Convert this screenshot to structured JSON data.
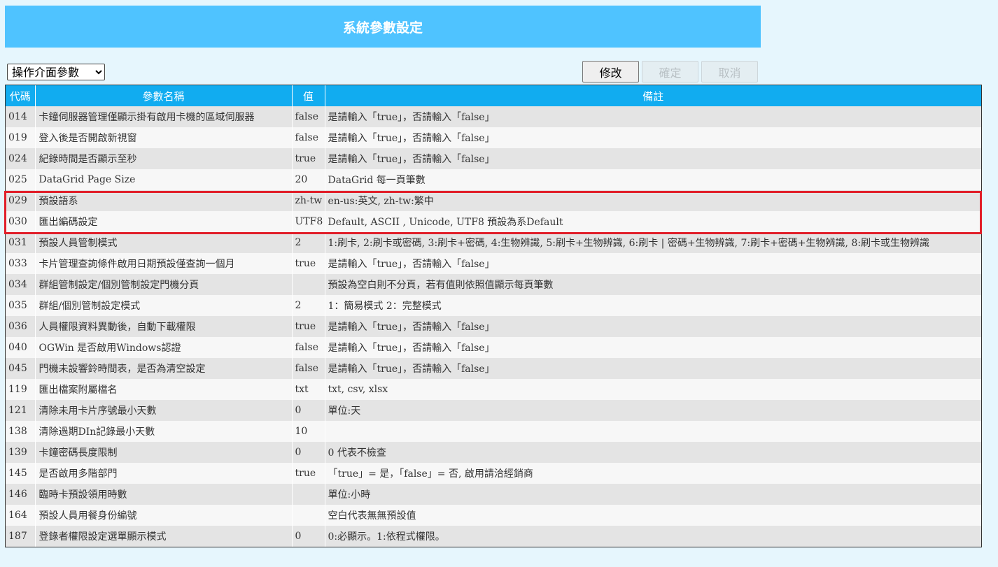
{
  "page": {
    "title": "系統參數設定",
    "category_selected": "操作介面參數",
    "buttons": {
      "edit": "修改",
      "confirm": "確定",
      "cancel": "取消"
    }
  },
  "table": {
    "headers": {
      "code": "代碼",
      "name": "參數名稱",
      "value": "值",
      "note": "備註"
    },
    "rows": [
      {
        "code": "014",
        "name": "卡鐘伺服器管理僅顯示掛有啟用卡機的區域伺服器",
        "value": "false",
        "note": "是請輸入「true」，否請輸入「false」"
      },
      {
        "code": "019",
        "name": "登入後是否開啟新視窗",
        "value": "false",
        "note": "是請輸入「true」，否請輸入「false」"
      },
      {
        "code": "024",
        "name": "紀錄時間是否顯示至秒",
        "value": "true",
        "note": "是請輸入「true」，否請輸入「false」"
      },
      {
        "code": "025",
        "name": "DataGrid Page Size",
        "value": "20",
        "note": "DataGrid 每一頁筆數"
      },
      {
        "code": "029",
        "name": "預設語系",
        "value": "zh-tw",
        "note": "en-us:英文, zh-tw:繁中"
      },
      {
        "code": "030",
        "name": "匯出編碼設定",
        "value": "UTF8",
        "note": "Default, ASCII , Unicode, UTF8 預設為系Default"
      },
      {
        "code": "031",
        "name": "預設人員管制模式",
        "value": "2",
        "note": "1:刷卡, 2:刷卡或密碼, 3:刷卡+密碼, 4:生物辨識, 5:刷卡+生物辨識, 6:刷卡 | 密碼+生物辨識, 7:刷卡+密碼+生物辨識, 8:刷卡或生物辨識"
      },
      {
        "code": "033",
        "name": "卡片管理查詢條件啟用日期預設僅查詢一個月",
        "value": "true",
        "note": "是請輸入「true」，否請輸入「false」"
      },
      {
        "code": "034",
        "name": "群組管制設定/個別管制設定門機分頁",
        "value": "",
        "note": "預設為空白則不分頁，若有值則依照值顯示每頁筆數"
      },
      {
        "code": "035",
        "name": "群組/個別管制設定模式",
        "value": "2",
        "note": "1：簡易模式 2：完整模式"
      },
      {
        "code": "036",
        "name": "人員權限資料異動後，自動下載權限",
        "value": "true",
        "note": "是請輸入「true」，否請輸入「false」"
      },
      {
        "code": "040",
        "name": "OGWin 是否啟用Windows認證",
        "value": "false",
        "note": "是請輸入「true」，否請輸入「false」"
      },
      {
        "code": "045",
        "name": "門機未設響鈴時間表，是否為清空設定",
        "value": "false",
        "note": "是請輸入「true」，否請輸入「false」"
      },
      {
        "code": "119",
        "name": "匯出檔案附屬檔名",
        "value": "txt",
        "note": "txt, csv, xlsx"
      },
      {
        "code": "121",
        "name": "清除未用卡片序號最小天數",
        "value": "0",
        "note": "單位:天"
      },
      {
        "code": "138",
        "name": "清除過期DIn記錄最小天數",
        "value": "10",
        "note": ""
      },
      {
        "code": "139",
        "name": "卡鐘密碼長度限制",
        "value": "0",
        "note": "0 代表不檢查"
      },
      {
        "code": "145",
        "name": "是否啟用多階部門",
        "value": "true",
        "note": "「true」= 是，「false」= 否, 啟用請洽經銷商"
      },
      {
        "code": "146",
        "name": "臨時卡預設領用時數",
        "value": "",
        "note": "單位:小時"
      },
      {
        "code": "164",
        "name": "預設人員用餐身份編號",
        "value": "",
        "note": "空白代表無無預設值"
      },
      {
        "code": "187",
        "name": "登錄者權限設定選單顯示模式",
        "value": "0",
        "note": "0:必顯示。1:依程式權限。"
      }
    ]
  },
  "colors": {
    "title_bar": "#4fc3ff",
    "header_row": "#11acf0",
    "highlight": "#e11f2a",
    "background": "#e6f6fd"
  }
}
